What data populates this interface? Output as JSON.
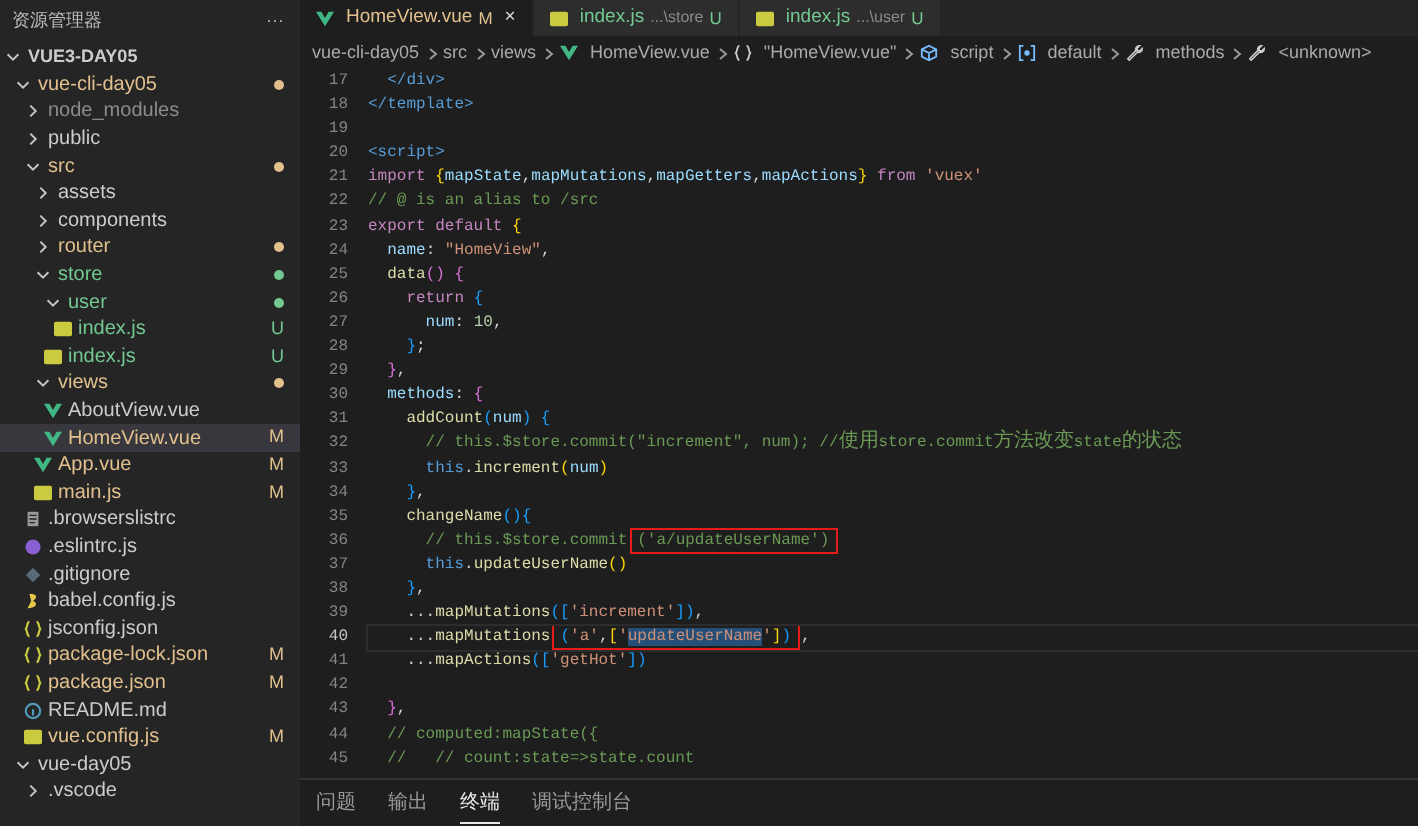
{
  "explorer": {
    "title": "资源管理器",
    "more": "···",
    "tree": [
      {
        "kind": "root",
        "name": "VUE3-DAY05",
        "expanded": true,
        "children": [
          {
            "kind": "folder",
            "name": "vue-cli-day05",
            "expanded": true,
            "color": "#e2c08d",
            "dot": true,
            "children": [
              {
                "kind": "folder",
                "name": "node_modules",
                "expanded": false,
                "color": "#8c8c8c"
              },
              {
                "kind": "folder",
                "name": "public",
                "expanded": false,
                "color": "#cccccc"
              },
              {
                "kind": "folder",
                "name": "src",
                "expanded": true,
                "color": "#e2c08d",
                "dot": true,
                "children": [
                  {
                    "kind": "folder",
                    "name": "assets",
                    "expanded": false,
                    "color": "#cccccc"
                  },
                  {
                    "kind": "folder",
                    "name": "components",
                    "expanded": false,
                    "color": "#cccccc"
                  },
                  {
                    "kind": "folder",
                    "name": "router",
                    "expanded": false,
                    "color": "#e2c08d",
                    "dot": true
                  },
                  {
                    "kind": "folder",
                    "name": "store",
                    "expanded": true,
                    "color": "#73c991",
                    "dot": true,
                    "children": [
                      {
                        "kind": "folder",
                        "name": "user",
                        "expanded": true,
                        "color": "#73c991",
                        "dot": true,
                        "children": [
                          {
                            "kind": "js",
                            "name": "index.js",
                            "color": "#73c991",
                            "badge": "U",
                            "selected": false
                          }
                        ]
                      },
                      {
                        "kind": "js",
                        "name": "index.js",
                        "color": "#73c991",
                        "badge": "U",
                        "selected": false
                      }
                    ]
                  },
                  {
                    "kind": "folder",
                    "name": "views",
                    "expanded": true,
                    "color": "#e2c08d",
                    "dot": true,
                    "children": [
                      {
                        "kind": "vue",
                        "name": "AboutView.vue",
                        "color": "#cccccc",
                        "selected": false
                      },
                      {
                        "kind": "vue",
                        "name": "HomeView.vue",
                        "color": "#e2c08d",
                        "badge": "M",
                        "selected": true
                      }
                    ]
                  },
                  {
                    "kind": "vue",
                    "name": "App.vue",
                    "color": "#e2c08d",
                    "badge": "M",
                    "selected": false
                  },
                  {
                    "kind": "js",
                    "name": "main.js",
                    "color": "#e2c08d",
                    "badge": "M",
                    "selected": false
                  }
                ]
              },
              {
                "kind": "list",
                "name": ".browserslistrc",
                "color": "#cccccc",
                "selected": false
              },
              {
                "kind": "eslint",
                "name": ".eslintrc.js",
                "color": "#cccccc",
                "selected": false
              },
              {
                "kind": "git",
                "name": ".gitignore",
                "color": "#cccccc",
                "selected": false
              },
              {
                "kind": "babel",
                "name": "babel.config.js",
                "color": "#cccccc",
                "selected": false
              },
              {
                "kind": "json",
                "name": "jsconfig.json",
                "color": "#cccccc",
                "selected": false
              },
              {
                "kind": "json",
                "name": "package-lock.json",
                "color": "#e2c08d",
                "badge": "M",
                "selected": false
              },
              {
                "kind": "json",
                "name": "package.json",
                "color": "#e2c08d",
                "badge": "M",
                "selected": false
              },
              {
                "kind": "info",
                "name": "README.md",
                "color": "#cccccc",
                "selected": false
              },
              {
                "kind": "js",
                "name": "vue.config.js",
                "color": "#e2c08d",
                "badge": "M",
                "selected": false
              }
            ]
          },
          {
            "kind": "folder",
            "name": "vue-day05",
            "expanded": true,
            "color": "#cccccc",
            "children": [
              {
                "kind": "folder",
                "name": ".vscode",
                "expanded": false,
                "color": "#cccccc"
              }
            ]
          }
        ]
      }
    ]
  },
  "tabs": [
    {
      "kind": "vue",
      "name": "HomeView.vue",
      "color": "#e2c08d",
      "badge": "M",
      "selected": true,
      "close": "×"
    },
    {
      "kind": "js",
      "name": "index.js",
      "path": "...\\store",
      "color": "#73c991",
      "badge": "U",
      "selected": false
    },
    {
      "kind": "js",
      "name": "index.js",
      "path": "...\\user",
      "color": "#73c991",
      "badge": "U",
      "selected": false
    }
  ],
  "breadcrumbs": [
    {
      "kind": "folder",
      "text": "vue-cli-day05"
    },
    {
      "kind": "folder",
      "text": "src"
    },
    {
      "kind": "folder",
      "text": "views"
    },
    {
      "kind": "vue",
      "text": "HomeView.vue"
    },
    {
      "kind": "braces",
      "text": "\"HomeView.vue\""
    },
    {
      "kind": "cube",
      "text": "script"
    },
    {
      "kind": "module",
      "text": "default"
    },
    {
      "kind": "wrench",
      "text": "methods"
    },
    {
      "kind": "wrench",
      "text": "<unknown>"
    }
  ],
  "code": {
    "lines": [
      {
        "number": "17",
        "current": false,
        "tokens": [
          {
            "kind": "tag",
            "text": "  </div>"
          }
        ]
      },
      {
        "number": "18",
        "current": false,
        "tokens": [
          {
            "kind": "tag",
            "text": "</template>"
          }
        ]
      },
      {
        "number": "19",
        "current": false
      },
      {
        "number": "20",
        "current": false,
        "tokens": [
          {
            "kind": "tag",
            "text": "<script>"
          }
        ]
      },
      {
        "number": "21",
        "current": false,
        "tokens": [
          {
            "kind": "kw",
            "text": "import "
          },
          {
            "kind": "b1",
            "text": "{"
          },
          {
            "kind": "var",
            "text": "mapState"
          },
          {
            "kind": "plain",
            "text": ","
          },
          {
            "kind": "var",
            "text": "mapMutations"
          },
          {
            "kind": "plain",
            "text": ","
          },
          {
            "kind": "var",
            "text": "mapGetters"
          },
          {
            "kind": "plain",
            "text": ","
          },
          {
            "kind": "var",
            "text": "mapActions"
          },
          {
            "kind": "b1",
            "text": "}"
          },
          {
            "kind": "kw",
            "text": " from "
          },
          {
            "kind": "str",
            "text": "'vuex'"
          }
        ]
      },
      {
        "number": "22",
        "current": false,
        "tokens": [
          {
            "kind": "cmt",
            "text": "// @ is an alias to /src"
          }
        ]
      },
      {
        "number": "23",
        "current": false,
        "tokens": [
          {
            "kind": "kw",
            "text": "export default "
          },
          {
            "kind": "b1",
            "text": "{"
          }
        ]
      },
      {
        "number": "24",
        "current": false,
        "tokens": [
          {
            "kind": "var",
            "text": "  name"
          },
          {
            "kind": "plain",
            "text": ": "
          },
          {
            "kind": "str",
            "text": "\"HomeView\""
          },
          {
            "kind": "plain",
            "text": ","
          }
        ]
      },
      {
        "number": "25",
        "current": false,
        "tokens": [
          {
            "kind": "fn",
            "text": "  data"
          },
          {
            "kind": "b2",
            "text": "() {"
          }
        ]
      },
      {
        "number": "26",
        "current": false,
        "tokens": [
          {
            "kind": "kw",
            "text": "    return "
          },
          {
            "kind": "b3",
            "text": "{"
          }
        ]
      },
      {
        "number": "27",
        "current": false,
        "tokens": [
          {
            "kind": "var",
            "text": "      num"
          },
          {
            "kind": "plain",
            "text": ": "
          },
          {
            "kind": "num",
            "text": "10"
          },
          {
            "kind": "plain",
            "text": ","
          }
        ]
      },
      {
        "number": "28",
        "current": false,
        "tokens": [
          {
            "kind": "b3",
            "text": "    }"
          },
          {
            "kind": "plain",
            "text": ";"
          }
        ]
      },
      {
        "number": "29",
        "current": false,
        "tokens": [
          {
            "kind": "b2",
            "text": "  }"
          },
          {
            "kind": "plain",
            "text": ","
          }
        ]
      },
      {
        "number": "30",
        "current": false,
        "tokens": [
          {
            "kind": "var",
            "text": "  methods"
          },
          {
            "kind": "plain",
            "text": ": "
          },
          {
            "kind": "b2",
            "text": "{"
          }
        ]
      },
      {
        "number": "31",
        "current": false,
        "tokens": [
          {
            "kind": "fn",
            "text": "    addCount"
          },
          {
            "kind": "b3",
            "text": "("
          },
          {
            "kind": "var",
            "text": "num"
          },
          {
            "kind": "b3",
            "text": ") {"
          }
        ]
      },
      {
        "number": "32",
        "current": false,
        "tokens": [
          {
            "kind": "cmt",
            "text": "      // this.$store.commit(\"increment\", num); //使用store.commit方法改变state的状态"
          }
        ]
      },
      {
        "number": "33",
        "current": false,
        "tokens": [
          {
            "kind": "this",
            "text": "      this"
          },
          {
            "kind": "plain",
            "text": "."
          },
          {
            "kind": "fn",
            "text": "increment"
          },
          {
            "kind": "b1",
            "text": "("
          },
          {
            "kind": "var",
            "text": "num"
          },
          {
            "kind": "b1",
            "text": ")"
          }
        ]
      },
      {
        "number": "34",
        "current": false,
        "tokens": [
          {
            "kind": "b3",
            "text": "    }"
          },
          {
            "kind": "plain",
            "text": ","
          }
        ]
      },
      {
        "number": "35",
        "current": false,
        "tokens": [
          {
            "kind": "fn",
            "text": "    changeName"
          },
          {
            "kind": "b3",
            "text": "(){"
          }
        ]
      },
      {
        "number": "36",
        "current": false,
        "tokens": [
          {
            "kind": "cmt",
            "text": "      // this.$store.commit"
          },
          {
            "boxed": true,
            "parts": [
              {
                "kind": "cmt",
                "text": "('a/updateUserName')"
              }
            ]
          }
        ]
      },
      {
        "number": "37",
        "current": false,
        "tokens": [
          {
            "kind": "this",
            "text": "      this"
          },
          {
            "kind": "plain",
            "text": "."
          },
          {
            "kind": "fn",
            "text": "updateUserName"
          },
          {
            "kind": "b1",
            "text": "()"
          }
        ]
      },
      {
        "number": "38",
        "current": false,
        "tokens": [
          {
            "kind": "b3",
            "text": "    }"
          },
          {
            "kind": "plain",
            "text": ","
          }
        ]
      },
      {
        "number": "39",
        "current": false,
        "tokens": [
          {
            "kind": "plain",
            "text": "    ..."
          },
          {
            "kind": "fn",
            "text": "mapMutations"
          },
          {
            "kind": "b3",
            "text": "(["
          },
          {
            "kind": "str",
            "text": "'increment'"
          },
          {
            "kind": "b3",
            "text": "])"
          },
          {
            "kind": "plain",
            "text": ","
          }
        ]
      },
      {
        "number": "40",
        "current": true,
        "tokens": [
          {
            "kind": "plain",
            "text": "    ..."
          },
          {
            "kind": "fn",
            "text": "mapMutations"
          },
          {
            "boxed": true,
            "parts": [
              {
                "kind": "b3",
                "text": "("
              },
              {
                "kind": "str",
                "text": "'a'"
              },
              {
                "kind": "plain",
                "text": ","
              },
              {
                "kind": "b1",
                "text": "["
              },
              {
                "kind": "str",
                "text": "'"
              },
              {
                "kind": "str",
                "text": "updateUserName",
                "selected": true
              },
              {
                "kind": "str",
                "text": "'"
              },
              {
                "kind": "b1",
                "text": "]"
              },
              {
                "kind": "b3",
                "text": ")"
              }
            ]
          },
          {
            "kind": "plain",
            "text": ","
          }
        ]
      },
      {
        "number": "41",
        "current": false,
        "tokens": [
          {
            "kind": "plain",
            "text": "    ..."
          },
          {
            "kind": "fn",
            "text": "mapActions"
          },
          {
            "kind": "b3",
            "text": "(["
          },
          {
            "kind": "str",
            "text": "'getHot'"
          },
          {
            "kind": "b3",
            "text": "])"
          }
        ]
      },
      {
        "number": "42",
        "current": false
      },
      {
        "number": "43",
        "current": false,
        "tokens": [
          {
            "kind": "b2",
            "text": "  }"
          },
          {
            "kind": "plain",
            "text": ","
          }
        ]
      },
      {
        "number": "44",
        "current": false,
        "tokens": [
          {
            "kind": "cmt",
            "text": "  // computed:mapState({"
          }
        ]
      },
      {
        "number": "45",
        "current": false,
        "tokens": [
          {
            "kind": "cmt",
            "text": "  //   // count:state=>state.count"
          }
        ]
      }
    ]
  },
  "panel_tabs": [
    {
      "label": "问题",
      "selected": false
    },
    {
      "label": "输出",
      "selected": false
    },
    {
      "label": "终端",
      "selected": true
    },
    {
      "label": "调试控制台",
      "selected": false
    }
  ]
}
